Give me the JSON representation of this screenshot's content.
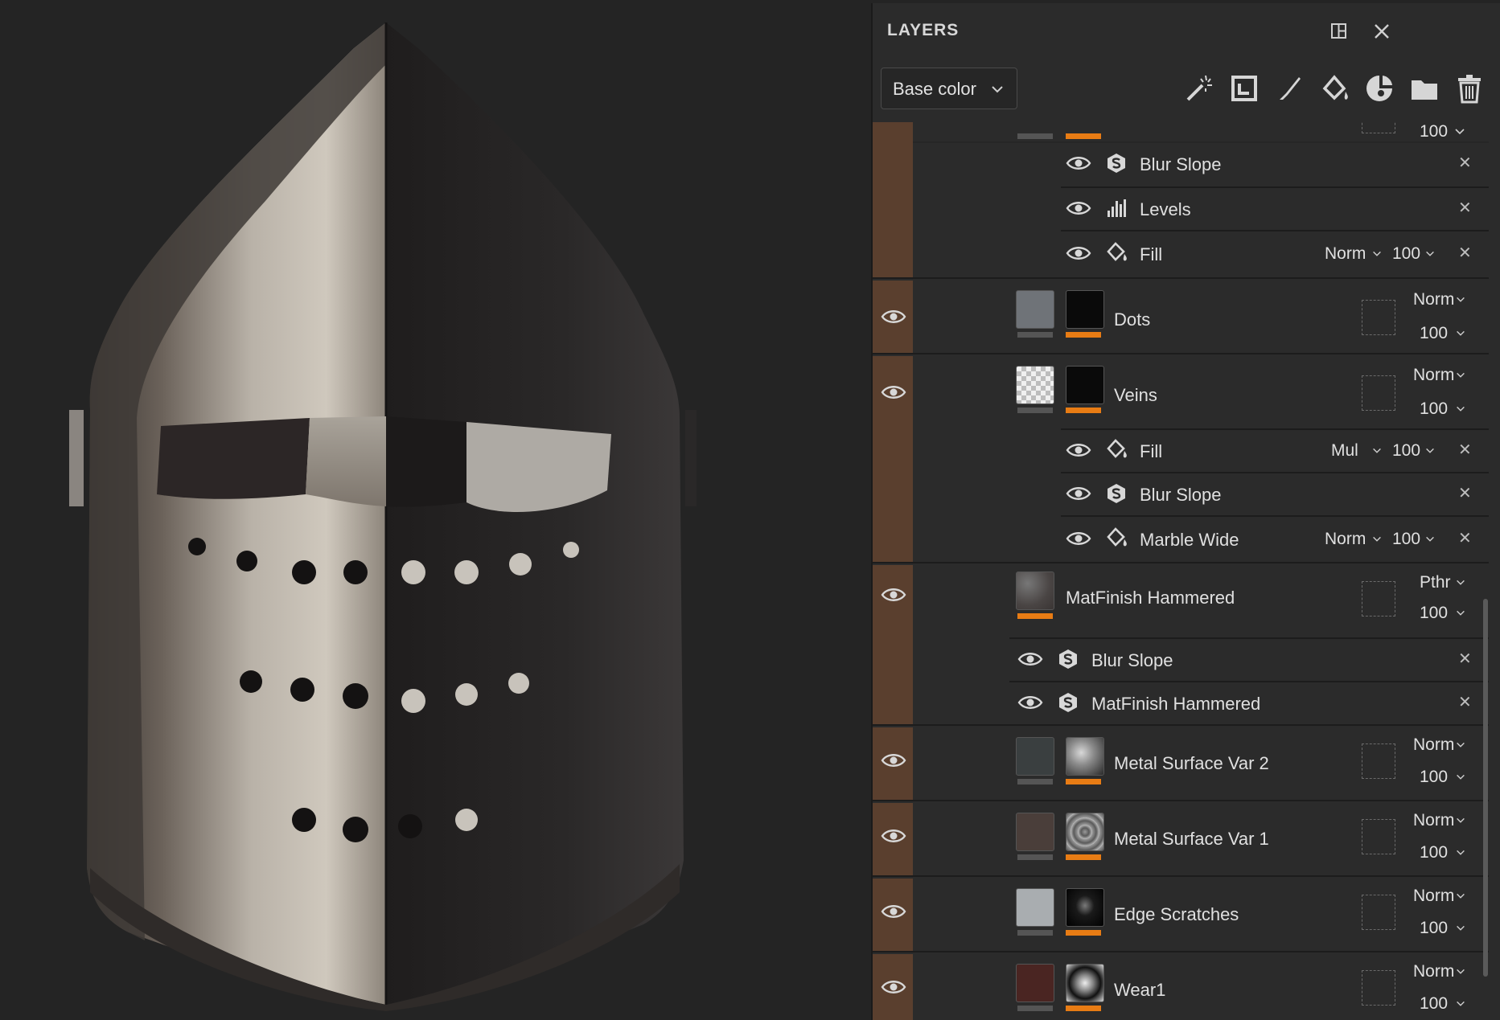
{
  "panel": {
    "title": "LAYERS",
    "channel_select": {
      "value": "Base color"
    },
    "tools": [
      "magic-wand-icon",
      "smart-mask-icon",
      "paint-brush-icon",
      "fill-bucket-icon",
      "effects-palette-icon",
      "folder-icon",
      "trash-icon"
    ]
  },
  "colors": {
    "accent_orange": "#e87c14",
    "group_strip": "#5a3f2e",
    "panel_bg": "#2b2b2b",
    "viewport_bg": "#242424"
  },
  "top_partial": {
    "opacity": "100"
  },
  "effects_top": [
    {
      "name": "Blur Slope",
      "icon": "filter-s-icon"
    },
    {
      "name": "Levels",
      "icon": "levels-icon"
    },
    {
      "name": "Fill",
      "icon": "fill-bucket-icon",
      "blend": "Norm",
      "opacity": "100"
    }
  ],
  "dots": {
    "name": "Dots",
    "blend": "Norm",
    "opacity": "100"
  },
  "veins": {
    "name": "Veins",
    "blend": "Norm",
    "opacity": "100"
  },
  "veins_effects": [
    {
      "name": "Fill",
      "icon": "fill-bucket-icon",
      "blend": "Mul",
      "opacity": "100"
    },
    {
      "name": "Blur Slope",
      "icon": "filter-s-icon"
    },
    {
      "name": "Marble Wide",
      "icon": "fill-bucket-icon",
      "blend": "Norm",
      "opacity": "100"
    }
  ],
  "matfinish": {
    "name": "MatFinish Hammered",
    "blend": "Pthr",
    "opacity": "100"
  },
  "matfinish_effects": [
    {
      "name": "Blur Slope",
      "icon": "filter-s-icon"
    },
    {
      "name": "MatFinish Hammered",
      "icon": "filter-s-icon"
    }
  ],
  "layers": [
    {
      "name": "Metal Surface Var 2",
      "blend": "Norm",
      "opacity": "100",
      "fill_color": "#3a3f40"
    },
    {
      "name": "Metal Surface Var 1",
      "blend": "Norm",
      "opacity": "100",
      "fill_color": "#4a3e3a"
    },
    {
      "name": "Edge Scratches",
      "blend": "Norm",
      "opacity": "100",
      "fill_color": "#a9adb0"
    },
    {
      "name": "Wear1",
      "blend": "Norm",
      "opacity": "100",
      "fill_color": "#4a2522"
    }
  ]
}
